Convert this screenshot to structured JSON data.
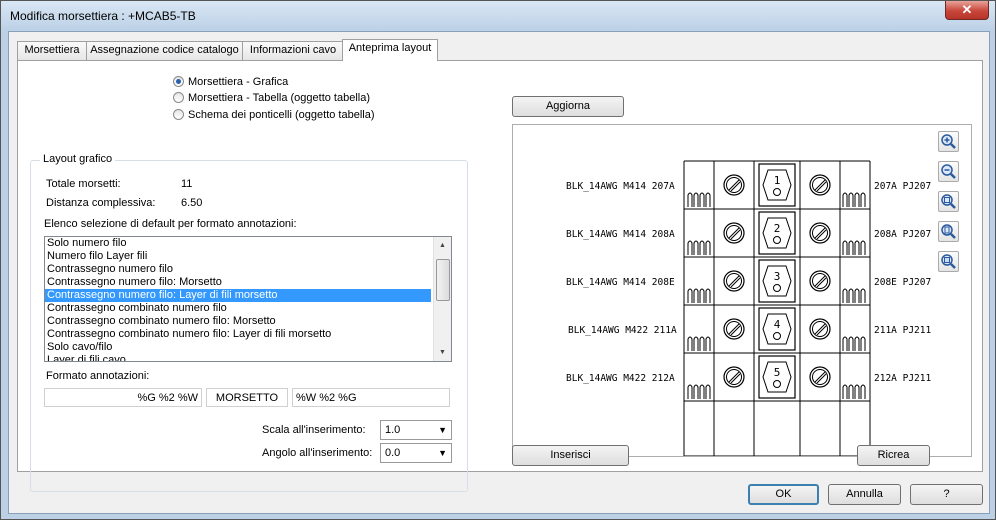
{
  "window": {
    "title": "Modifica morsettiera : +MCAB5-TB",
    "close_symbol": "✕"
  },
  "tabs": [
    {
      "label": "Morsettiera"
    },
    {
      "label": "Assegnazione codice catalogo"
    },
    {
      "label": "Informazioni cavo"
    },
    {
      "label": "Anteprima layout"
    }
  ],
  "radio_options": [
    {
      "label": "Morsettiera - Grafica",
      "checked": true
    },
    {
      "label": "Morsettiera - Tabella (oggetto tabella)",
      "checked": false
    },
    {
      "label": "Schema dei ponticelli (oggetto tabella)",
      "checked": false
    }
  ],
  "layout": {
    "group_label": "Layout grafico",
    "total_terminals_label": "Totale morsetti:",
    "total_terminals_value": "11",
    "total_distance_label": "Distanza complessiva:",
    "total_distance_value": "6.50",
    "list_label": "Elenco selezione di default per formato annotazioni:",
    "list_items": [
      "Solo numero filo",
      "Numero filo Layer fili",
      "Contrassegno numero filo",
      "Contrassegno numero filo: Morsetto",
      "Contrassegno numero filo: Layer di fili morsetto",
      "Contrassegno combinato numero filo",
      "Contrassegno combinato numero filo: Morsetto",
      "Contrassegno combinato numero filo: Layer di fili morsetto",
      "Solo cavo/filo",
      "Layer di fili cavo"
    ],
    "selected_index": 4,
    "format_label": "Formato annotazioni:",
    "format_left": "%G %2 %W",
    "format_middle": "MORSETTO",
    "format_right": "%W %2 %G",
    "scale_label": "Scala all'inserimento:",
    "scale_value": "1.0",
    "angle_label": "Angolo all'inserimento:",
    "angle_value": "0.0"
  },
  "preview": {
    "refresh_button": "Aggiorna",
    "insert_button": "Inserisci",
    "recreate_button": "Ricrea",
    "zoom_icons": [
      "zoom-in-icon",
      "zoom-out-icon",
      "zoom-window-icon",
      "zoom-extents-icon",
      "zoom-previous-icon"
    ],
    "rows": [
      {
        "left": "BLK_14AWG  M414  207A",
        "number": "1",
        "right": "207A  PJ207"
      },
      {
        "left": "BLK_14AWG  M414  208A",
        "number": "2",
        "right": "208A  PJ207"
      },
      {
        "left": "BLK_14AWG  M414  208E",
        "number": "3",
        "right": "208E  PJ207"
      },
      {
        "left": "BLK_14AWG  M422  211A",
        "number": "4",
        "right": "211A  PJ211"
      },
      {
        "left": "BLK_14AWG  M422  212A",
        "number": "5",
        "right": "212A  PJ211"
      }
    ]
  },
  "footer": {
    "ok": "OK",
    "cancel": "Annulla",
    "help": "?"
  }
}
